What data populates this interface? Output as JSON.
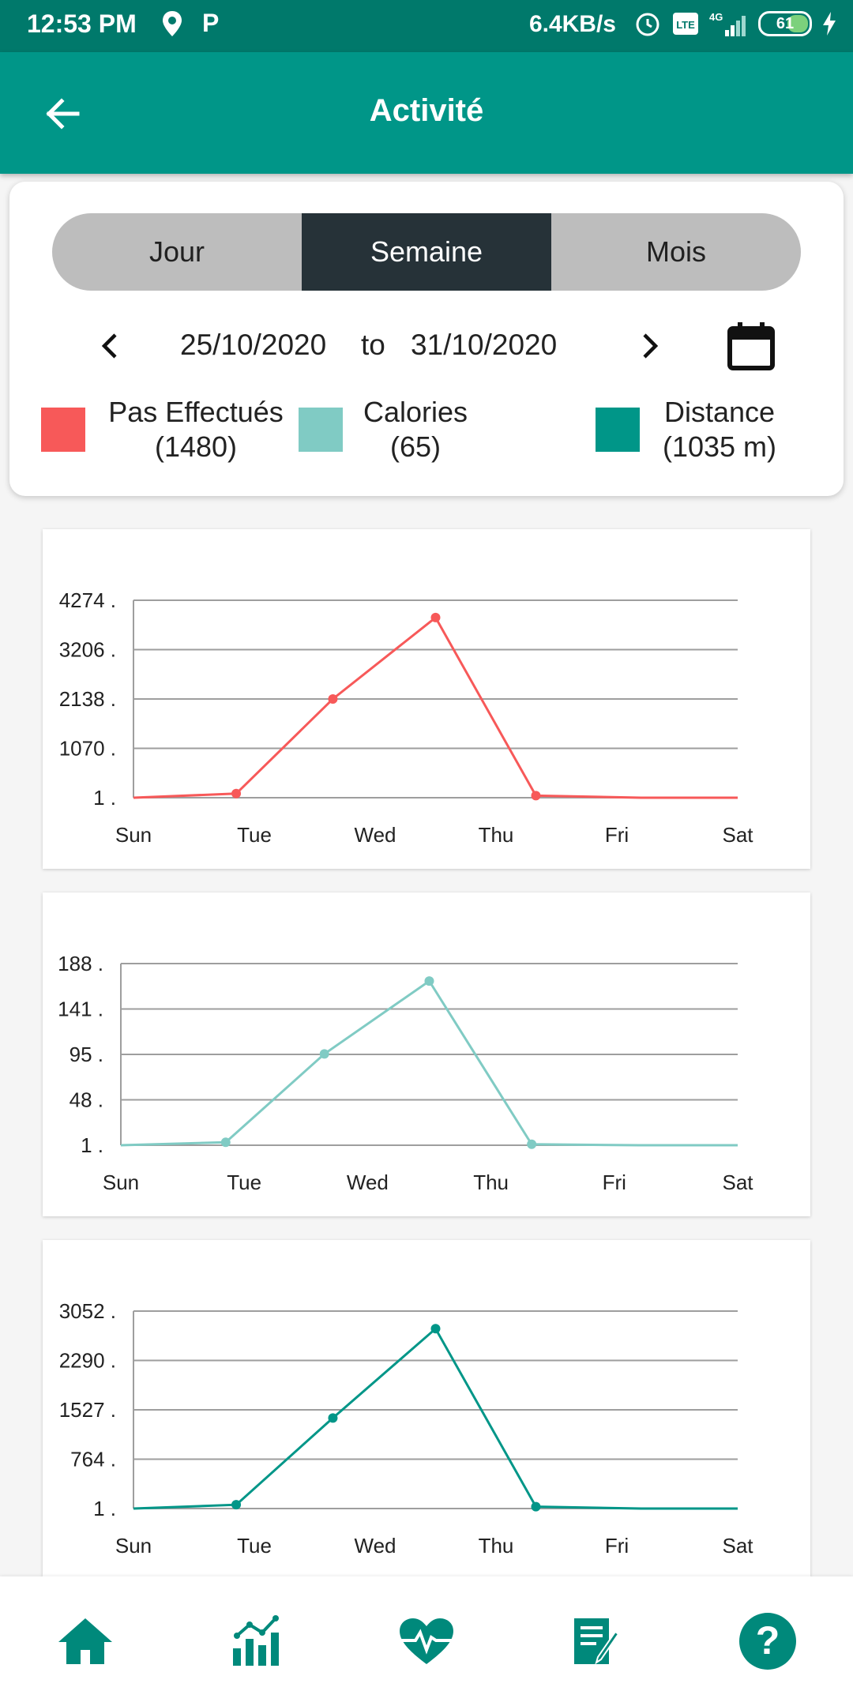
{
  "status_bar": {
    "time": "12:53 PM",
    "speed": "6.4KB/s",
    "network": "4G",
    "battery": "61"
  },
  "app_bar": {
    "title": "Activité"
  },
  "period_tabs": [
    {
      "label": "Jour",
      "active": false
    },
    {
      "label": "Semaine",
      "active": true
    },
    {
      "label": "Mois",
      "active": false
    }
  ],
  "date_range": {
    "start": "25/10/2020",
    "separator": "to",
    "end": "31/10/2020"
  },
  "legend": [
    {
      "label": "Pas Effectués",
      "value": "(1480)",
      "color": "#f75959"
    },
    {
      "label": "Calories",
      "value": "(65)",
      "color": "#80cbc4"
    },
    {
      "label": "Distance",
      "value": "(1035 m)",
      "color": "#009688"
    }
  ],
  "chart_data": [
    {
      "type": "line",
      "categories": [
        "Sun",
        "Tue",
        "Wed",
        "Thu",
        "Fri",
        "Sat"
      ],
      "yticks": [
        "4274",
        "3206",
        "2138",
        "1070",
        "1"
      ],
      "ylim": [
        1,
        4274
      ],
      "color": "#f75959",
      "points": [
        [
          0,
          1
        ],
        [
          0.85,
          90
        ],
        [
          1.65,
          2138
        ],
        [
          2.5,
          3900
        ],
        [
          3.33,
          45
        ],
        [
          4.2,
          1
        ],
        [
          5,
          1
        ]
      ]
    },
    {
      "type": "line",
      "categories": [
        "Sun",
        "Tue",
        "Wed",
        "Thu",
        "Fri",
        "Sat"
      ],
      "yticks": [
        "188",
        "141",
        "95",
        "48",
        "1"
      ],
      "ylim": [
        1,
        188
      ],
      "color": "#80cbc4",
      "points": [
        [
          0,
          1
        ],
        [
          0.85,
          4
        ],
        [
          1.65,
          95
        ],
        [
          2.5,
          170
        ],
        [
          3.33,
          2
        ],
        [
          4.2,
          1
        ],
        [
          5,
          1
        ]
      ]
    },
    {
      "type": "line",
      "categories": [
        "Sun",
        "Tue",
        "Wed",
        "Thu",
        "Fri",
        "Sat"
      ],
      "yticks": [
        "3052",
        "2290",
        "1527",
        "764",
        "1"
      ],
      "ylim": [
        1,
        3052
      ],
      "color": "#009688",
      "points": [
        [
          0,
          1
        ],
        [
          0.85,
          60
        ],
        [
          1.65,
          1400
        ],
        [
          2.5,
          2780
        ],
        [
          3.33,
          30
        ],
        [
          4.2,
          1
        ],
        [
          5,
          1
        ]
      ]
    }
  ],
  "bottom_nav": [
    {
      "icon": "home-icon"
    },
    {
      "icon": "stats-icon"
    },
    {
      "icon": "heart-pulse-icon"
    },
    {
      "icon": "notes-icon"
    },
    {
      "icon": "help-icon"
    }
  ]
}
